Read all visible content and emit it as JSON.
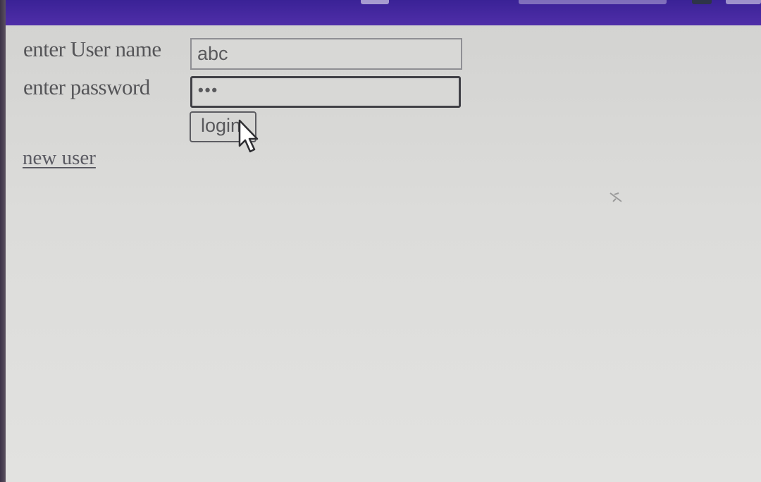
{
  "form": {
    "username_label": "enter User name",
    "username_value": "abc",
    "password_label": "enter password",
    "password_value": "•••",
    "login_label": "login"
  },
  "links": {
    "new_user": "new user"
  },
  "icons": {
    "cursor": "mouse-pointer-icon"
  },
  "colors": {
    "top_bar": "#4f2ea8",
    "page_background": "#dcdcda",
    "text": "#555558"
  }
}
